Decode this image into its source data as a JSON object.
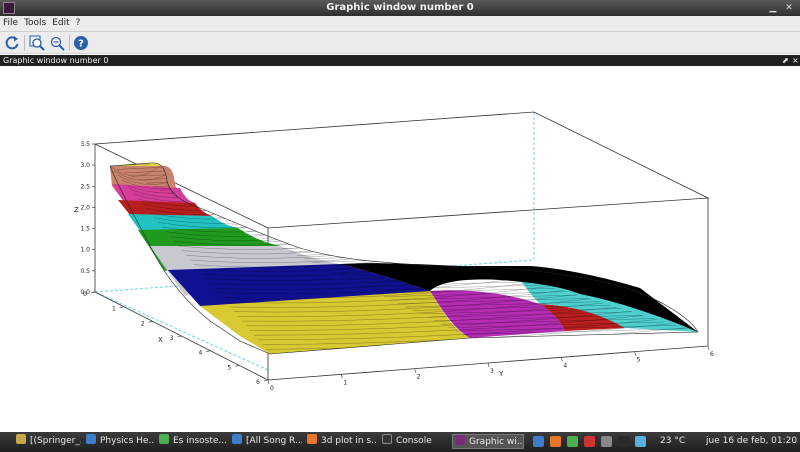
{
  "window": {
    "title": "Graphic window number 0"
  },
  "menu": [
    "File",
    "Tools",
    "Edit",
    "?"
  ],
  "toolbar": [
    {
      "name": "rotate-icon",
      "color": "#2b5fa8"
    },
    {
      "name": "zoom-in-icon",
      "color": "#2b5fa8"
    },
    {
      "name": "zoom-out-icon",
      "color": "#2b5fa8"
    },
    {
      "name": "help-icon",
      "color": "#2b5fa8"
    }
  ],
  "panel": {
    "title": "Graphic window number 0",
    "undock_glyph": "⬈",
    "close_glyph": "×"
  },
  "plot": {
    "z_label": "Z",
    "x_label": "X",
    "y_label": "Y",
    "z_ticks": [
      "0.0",
      "0.5",
      "1.0",
      "1.5",
      "2.0",
      "2.5",
      "3.0",
      "3.5"
    ],
    "x_ticks": [
      "0",
      "1",
      "2",
      "3",
      "4",
      "5",
      "6"
    ],
    "y_ticks": [
      "0",
      "1",
      "2",
      "3",
      "4",
      "5",
      "6"
    ],
    "band_colors": [
      "#e8d44a",
      "#c9826e",
      "#d63d9b",
      "#b81e1e",
      "#22c2c2",
      "#1f9a1f",
      "#c8c8d0",
      "#101090",
      "#d8c832",
      "#b52cb5",
      "#bb2020",
      "#4ed0d0",
      "#000000"
    ]
  },
  "taskbar": {
    "tasks": [
      {
        "label": "[(Springer_...",
        "color": "#c8a64a"
      },
      {
        "label": "Physics He...",
        "color": "#3d7ec8"
      },
      {
        "label": "Es insoste...",
        "color": "#4caf50"
      },
      {
        "label": "[All Song R...",
        "color": "#3d7ec8"
      },
      {
        "label": "3d plot in s...",
        "color": "#e8762a"
      },
      {
        "label": "Console",
        "color": "#333333"
      },
      {
        "label": "Graphic wi...",
        "color": "#7a2a7a"
      }
    ],
    "tray_colors": [
      "#3d7ec8",
      "#e8762a",
      "#4caf50",
      "#c33",
      "#888888",
      "#2a2a2a",
      "#5ab0e0"
    ],
    "temperature": "23 °C",
    "clock": "jue 16 de feb, 01:20"
  }
}
